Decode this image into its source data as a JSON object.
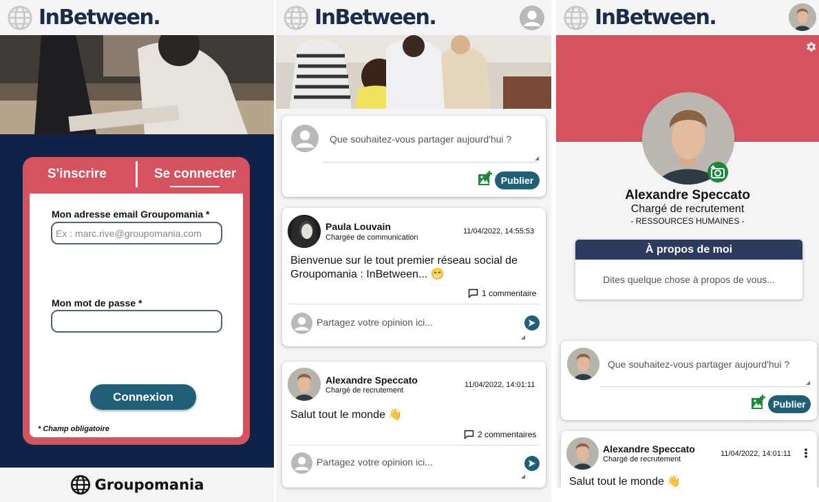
{
  "brand": {
    "app_name": "InBetween",
    "app_dot": ".",
    "company": "Groupomania",
    "accent": "#d4535f",
    "primary": "#1f5f78",
    "navy": "#0f2248"
  },
  "login": {
    "tab_signup": "S'inscrire",
    "tab_login": "Se connecter",
    "active_tab": "Se connecter",
    "email_label": "Mon adresse email Groupomania *",
    "email_placeholder": "Ex : marc.rive@groupomania.com",
    "email_value": "",
    "password_label": "Mon mot de passe *",
    "password_value": "",
    "submit_label": "Connexion",
    "required_note": "* Champ obligatoire"
  },
  "feed": {
    "composer": {
      "placeholder": "Que souhaitez-vous partager aujourd'hui ?",
      "publish_label": "Publier",
      "icon": "image-add-icon"
    },
    "comment_placeholder": "Partagez votre opinion ici...",
    "posts": [
      {
        "author": "Paula Louvain",
        "role": "Chargée de communication",
        "date": "11/04/2022, 14:55:53",
        "body": "Bienvenue sur le tout premier réseau social de Groupomania : InBetween... 😁",
        "comments": "1 commentaire"
      },
      {
        "author": "Alexandre Speccato",
        "role": "Chargé de recrutement",
        "date": "11/04/2022, 14:01:11",
        "body": "Salut tout le monde 👋",
        "comments": "2 commentaires"
      }
    ]
  },
  "profile": {
    "name": "Alexandre Speccato",
    "role": "Chargé de recrutement",
    "department": "- RESSOURCES HUMAINES -",
    "about_title": "À propos de moi",
    "about_placeholder": "Dites quelque chose à propos de vous...",
    "composer_placeholder": "Que souhaitez-vous partager aujourd'hui ?",
    "publish_label": "Publier",
    "post": {
      "author": "Alexandre Speccato",
      "role": "Chargé de recrutement",
      "date": "11/04/2022, 14:01:11",
      "body": "Salut tout le monde 👋"
    }
  }
}
